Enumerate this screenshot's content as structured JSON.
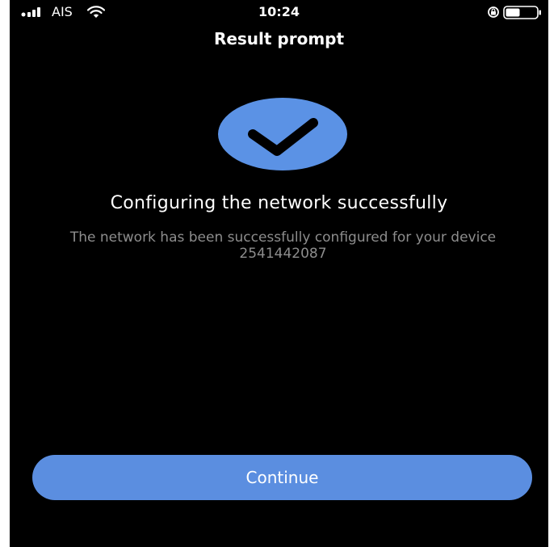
{
  "status_bar": {
    "carrier": "AIS",
    "time": "10:24",
    "icons": [
      "signal-icon",
      "wifi-icon",
      "orientation-lock-icon",
      "battery-icon"
    ]
  },
  "header": {
    "title": "Result prompt"
  },
  "result": {
    "icon": "checkmark-icon",
    "headline": "Configuring the network successfully",
    "message": "The network has been successfully configured for your device 2541442087"
  },
  "actions": {
    "continue_label": "Continue"
  },
  "colors": {
    "background": "#000000",
    "accent": "#5b8ee0",
    "badge": "#5b92e5",
    "message_text": "#8d8d8d"
  }
}
